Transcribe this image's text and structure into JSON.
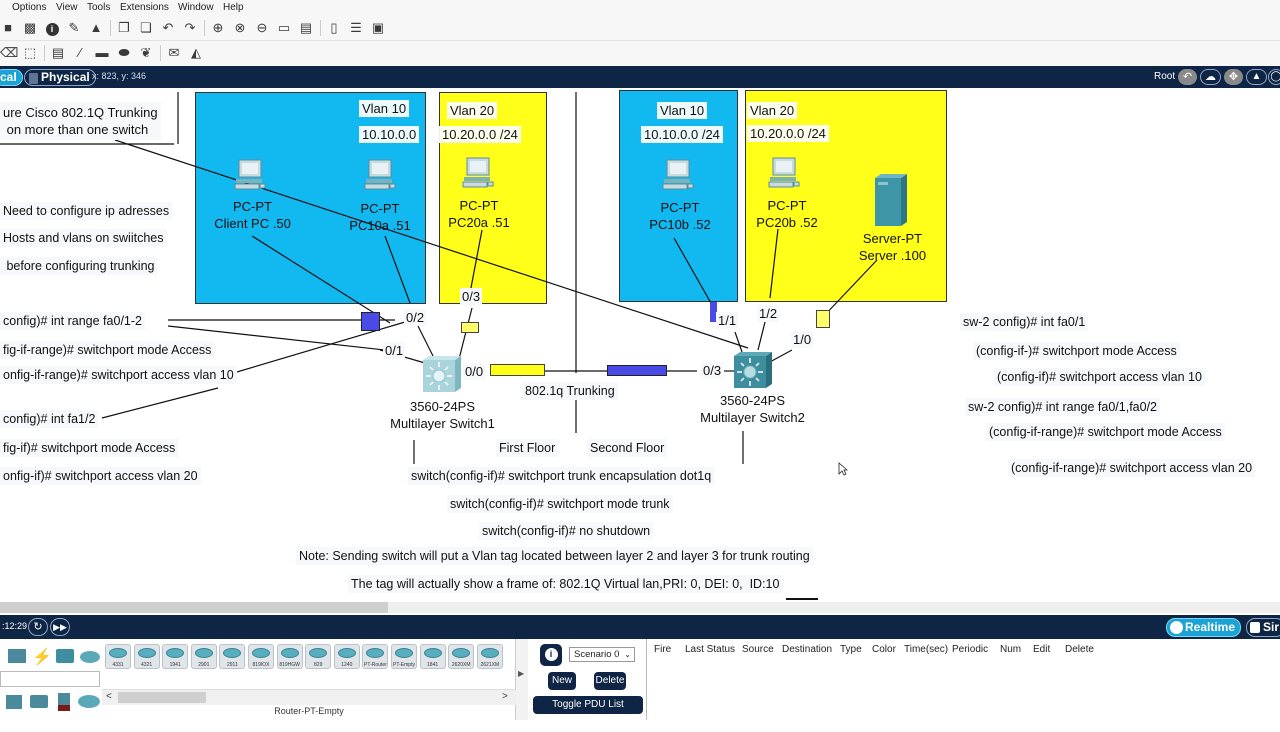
{
  "menu": [
    "Options",
    "View",
    "Tools",
    "Extensions",
    "Window",
    "Help"
  ],
  "toolbar1_icons": [
    "save-icon",
    "print-icon",
    "info-icon",
    "activity-wizard-icon",
    "lab-icon",
    "copy-icon",
    "paste-icon",
    "undo-icon",
    "redo-icon",
    "zoom-in-icon",
    "zoom-reset-icon",
    "zoom-out-icon",
    "drawing-palette-icon",
    "custom-device-icon",
    "viewport-icon",
    "tile-icon",
    "image-icon"
  ],
  "toolbar2_icons": [
    "delete-icon",
    "resize-icon",
    "note-icon",
    "line-icon",
    "rectangle-icon",
    "ellipse-icon",
    "freeform-icon",
    "add-simple-pdu-icon",
    "add-complex-pdu-icon"
  ],
  "modebar": {
    "logical_tab": "cal",
    "physical_tab": "Physical",
    "coords": "x: 823, y: 346",
    "root_label": "Root"
  },
  "canvas": {
    "vlan_boxes": [
      {
        "vlan": "Vlan 10",
        "subnet": "10.10.0.0",
        "color": "#12b8f0"
      },
      {
        "vlan": "Vlan 20",
        "subnet": "10.20.0.0 /24",
        "color": "#ffff1a"
      },
      {
        "vlan": "Vlan 10",
        "subnet": "10.10.0.0 /24",
        "color": "#12b8f0"
      },
      {
        "vlan": "Vlan 20",
        "subnet": "10.20.0.0 /24",
        "color": "#ffff1a"
      }
    ],
    "devices": [
      {
        "type": "PC-PT",
        "name": "Client PC .50"
      },
      {
        "type": "PC-PT",
        "name": "PC10a  .51"
      },
      {
        "type": "PC-PT",
        "name": "PC20a  .51"
      },
      {
        "type": "PC-PT",
        "name": "PC10b  .52"
      },
      {
        "type": "PC-PT",
        "name": "PC20b  .52"
      },
      {
        "type": "Server-PT",
        "name": "Server  .100"
      }
    ],
    "switches": [
      {
        "model": "3560-24PS",
        "name": "Multilayer Switch1"
      },
      {
        "model": "3560-24PS",
        "name": "Multilayer Switch2"
      }
    ],
    "ports": {
      "sw1_p03": "0/3",
      "sw1_p02": "0/2",
      "sw1_p01": "0/1",
      "sw1_p00": "0/0",
      "sw2_p03": "0/3",
      "sw2_p11": "1/1",
      "sw2_p12": "1/2",
      "sw2_p10": "1/0"
    },
    "trunk_label": "802.1q Trunking",
    "floor1": "First Floor",
    "floor2": "Second Floor",
    "title_note": [
      "ure Cisco 802.1Q Trunking",
      " on more than one switch"
    ],
    "left_notes": [
      "Need to configure ip adresses",
      "Hosts and vlans on swiitches",
      " before configuring trunking"
    ],
    "sw1_cmds": [
      "config)# int range fa0/1-2",
      "fig-if-range)# switchport mode Access",
      "onfig-if-range)# switchport access vlan 10",
      "config)# int fa1/2",
      "fig-if)# switchport mode Access",
      "onfig-if)# switchport access vlan 20"
    ],
    "sw2_cmds": [
      "sw-2 config)# int fa0/1",
      "(config-if-)# switchport mode Access",
      "(config-if)# switchport access vlan 10",
      "sw-2 config)# int range fa0/1,fa0/2",
      "(config-if-range)# switchport mode Access",
      "(config-if-range)# switchport access vlan 20"
    ],
    "trunk_cmds": [
      "switch(config-if)# switchport trunk encapsulation dot1q",
      "switch(config-if)# switchport mode trunk",
      "switch(config-if)# no shutdown"
    ],
    "note_line1": "Note: Sending switch will put a Vlan tag located between layer 2 and layer 3 for trunk routing",
    "note_line2": "The tag will actually show a frame of: 802.1Q Virtual lan,PRI: 0, DEI: 0,  ID:10"
  },
  "bottombar": {
    "time": ":12:29",
    "realtime_label": "Realtime",
    "sim_label": "Sir"
  },
  "device_models": [
    "4331",
    "4321",
    "1941",
    "2901",
    "2911",
    "819IOX",
    "819HGW",
    "829",
    "1240",
    "PT-Router",
    "PT-Empty",
    "1841",
    "2620XM",
    "2621XM"
  ],
  "selected_device": "Router-PT-Empty",
  "pdu": {
    "scenario": "Scenario 0",
    "new_label": "New",
    "delete_label": "Delete",
    "toggle_label": "Toggle PDU List Window",
    "columns": [
      "Fire",
      "Last Status",
      "Source",
      "Destination",
      "Type",
      "Color",
      "Time(sec)",
      "Periodic",
      "Num",
      "Edit",
      "Delete"
    ]
  }
}
